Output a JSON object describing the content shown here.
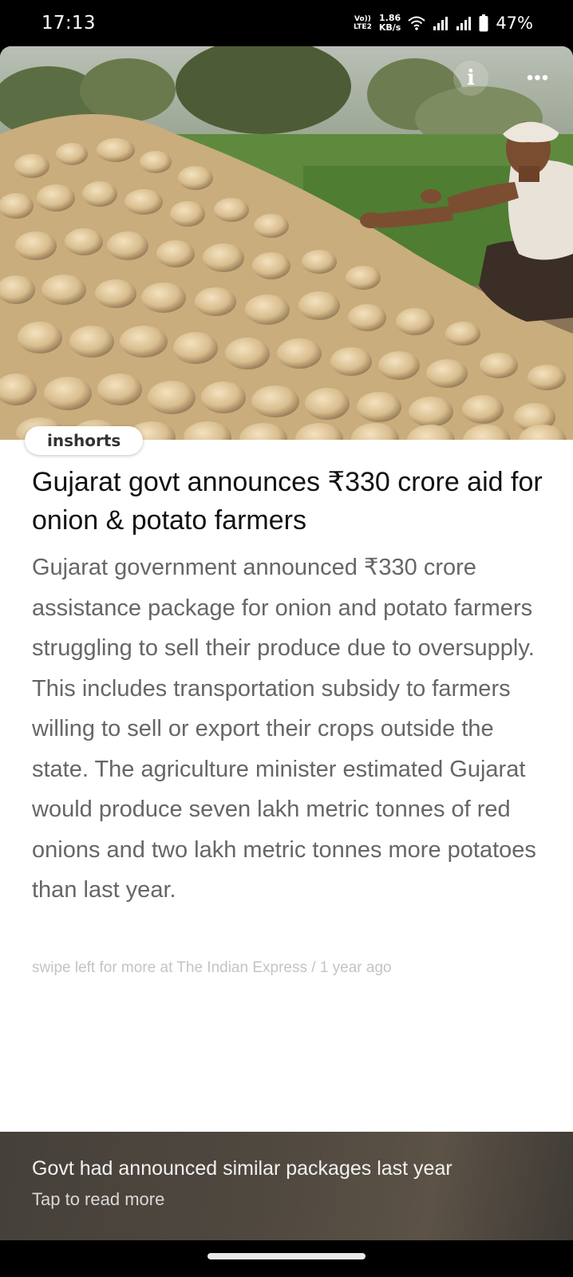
{
  "status_bar": {
    "time": "17:13",
    "volte_top": "Vo))",
    "volte_bottom": "LTE2",
    "speed_value": "1.86",
    "speed_unit": "KB/s",
    "battery": "47%"
  },
  "hero": {
    "info_icon_glyph": "i",
    "more_icon_glyph": "•••"
  },
  "brand": "inshorts",
  "article": {
    "headline": "Gujarat govt announces ₹330 crore aid for onion & potato farmers",
    "body": "Gujarat government announced ₹330 crore assistance package for onion and potato farmers struggling to sell their produce due to oversupply. This includes transportation subsidy to farmers willing to sell or export their crops outside the state. The agriculture minister estimated Gujarat would produce seven lakh metric tonnes of red onions and two lakh metric tonnes more potatoes than last year.",
    "source_prefix": "swipe left for more at ",
    "source_name": "The Indian Express",
    "source_time": " / 1 year ago"
  },
  "footer": {
    "title": "Govt had announced similar packages last year",
    "subtitle": "Tap to read more"
  },
  "colors": {
    "background": "#ffffff",
    "headline": "#111111",
    "body": "#666666",
    "source": "#c4c4c4"
  }
}
